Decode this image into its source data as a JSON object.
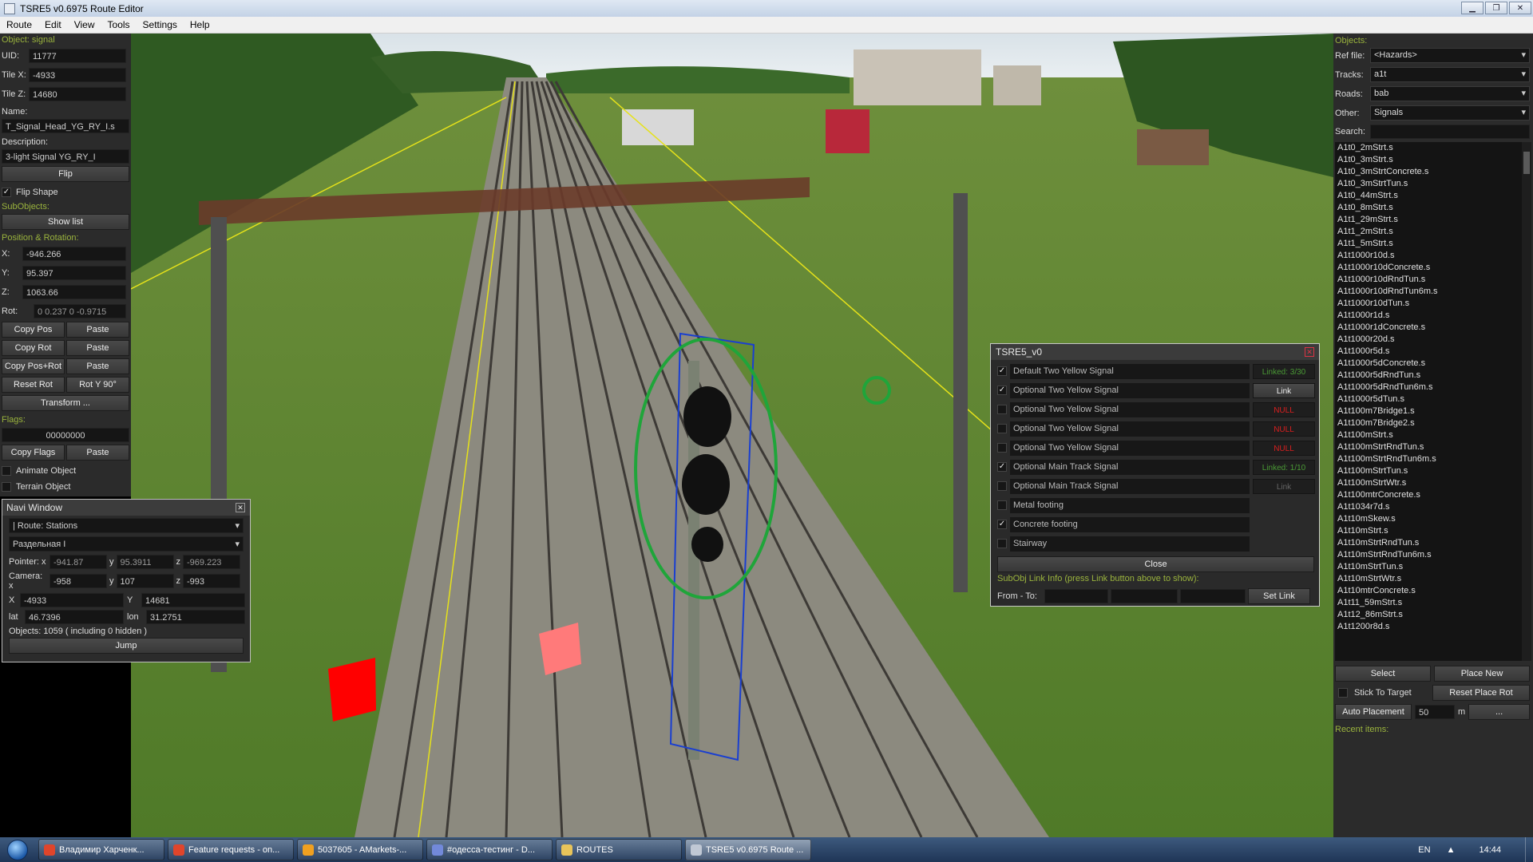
{
  "window": {
    "title": "TSRE5 v0.6975 Route Editor"
  },
  "menu": [
    "Route",
    "Edit",
    "View",
    "Tools",
    "Settings",
    "Help"
  ],
  "left": {
    "object_label": "Object: signal",
    "uid_label": "UID:",
    "uid": "11777",
    "tilex_label": "Tile X:",
    "tilex": "-4933",
    "tilez_label": "Tile Z:",
    "tilez": "14680",
    "name_label": "Name:",
    "name": "T_Signal_Head_YG_RY_I.s",
    "desc_label": "Description:",
    "desc": "3-light Signal YG_RY_I",
    "flip": "Flip",
    "flip_shape": "Flip Shape",
    "subobjects_label": "SubObjects:",
    "show_list": "Show list",
    "posrot_label": "Position & Rotation:",
    "x_label": "X:",
    "x": "-946.266",
    "y_label": "Y:",
    "y": "95.397",
    "z_label": "Z:",
    "z": "1063.66",
    "rot_label": "Rot:",
    "rot": "0 0.237 0 -0.9715",
    "copy_pos": "Copy Pos",
    "paste1": "Paste",
    "copy_rot": "Copy Rot",
    "paste2": "Paste",
    "copy_posrot": "Copy Pos+Rot",
    "paste3": "Paste",
    "reset_rot": "Reset Rot",
    "rot_y": "Rot Y 90°",
    "transform": "Transform ...",
    "flags_label": "Flags:",
    "flags": "00000000",
    "copy_flags": "Copy Flags",
    "paste4": "Paste",
    "animate": "Animate Object",
    "terrain": "Terrain Object"
  },
  "navi": {
    "title": "Navi Window",
    "route": "| Route: Stations",
    "station": "Раздельная I",
    "pointer_label": "Pointer: x",
    "pointer_x": "-941.87",
    "pointer_y": "95.3911",
    "pointer_z": "-969.223",
    "camera_label": "Camera: x",
    "camera_x": "-958",
    "camera_y": "107",
    "camera_z": "-993",
    "y_label": "y",
    "z_label": "z",
    "tx_label": "X",
    "tx": "-4933",
    "ty_label": "Y",
    "ty": "14681",
    "lat_label": "lat",
    "lat": "46.7396",
    "lon_label": "lon",
    "lon": "31.2751",
    "objects": "Objects: 1059 ( including 0 hidden )",
    "jump": "Jump"
  },
  "dialog": {
    "title": "TSRE5_v0",
    "rows": [
      {
        "checked": true,
        "name": "Default Two Yellow Signal",
        "link": "Linked: 3/30",
        "link_state": "green"
      },
      {
        "checked": true,
        "name": "Optional Two Yellow Signal",
        "link": "Link",
        "link_state": "active"
      },
      {
        "checked": false,
        "name": "Optional Two Yellow Signal",
        "link": "NULL",
        "link_state": "red"
      },
      {
        "checked": false,
        "name": "Optional Two Yellow Signal",
        "link": "NULL",
        "link_state": "red"
      },
      {
        "checked": false,
        "name": "Optional Two Yellow Signal",
        "link": "NULL",
        "link_state": "red"
      },
      {
        "checked": true,
        "name": "Optional Main Track Signal",
        "link": "Linked: 1/10",
        "link_state": "green"
      },
      {
        "checked": false,
        "name": "Optional Main Track Signal",
        "link": "Link",
        "link_state": "dim"
      },
      {
        "checked": false,
        "name": "Metal footing",
        "link": "",
        "link_state": ""
      },
      {
        "checked": true,
        "name": "Concrete footing",
        "link": "",
        "link_state": ""
      },
      {
        "checked": false,
        "name": "Stairway",
        "link": "",
        "link_state": ""
      }
    ],
    "close": "Close",
    "info": "SubObj Link Info (press Link button above to show):",
    "from_to": "From - To:",
    "set_link": "Set Link"
  },
  "right": {
    "objects_label": "Objects:",
    "ref_label": "Ref file:",
    "ref": "<Hazards>",
    "tracks_label": "Tracks:",
    "tracks": "a1t",
    "roads_label": "Roads:",
    "roads": "bab",
    "other_label": "Other:",
    "other": "Signals",
    "search_label": "Search:",
    "items": [
      "A1t0_2mStrt.s",
      "A1t0_3mStrt.s",
      "A1t0_3mStrtConcrete.s",
      "A1t0_3mStrtTun.s",
      "A1t0_44mStrt.s",
      "A1t0_8mStrt.s",
      "A1t1_29mStrt.s",
      "A1t1_2mStrt.s",
      "A1t1_5mStrt.s",
      "A1t1000r10d.s",
      "A1t1000r10dConcrete.s",
      "A1t1000r10dRndTun.s",
      "A1t1000r10dRndTun6m.s",
      "A1t1000r10dTun.s",
      "A1t1000r1d.s",
      "A1t1000r1dConcrete.s",
      "A1t1000r20d.s",
      "A1t1000r5d.s",
      "A1t1000r5dConcrete.s",
      "A1t1000r5dRndTun.s",
      "A1t1000r5dRndTun6m.s",
      "A1t1000r5dTun.s",
      "A1t100m7Bridge1.s",
      "A1t100m7Bridge2.s",
      "A1t100mStrt.s",
      "A1t100mStrtRndTun.s",
      "A1t100mStrtRndTun6m.s",
      "A1t100mStrtTun.s",
      "A1t100mStrtWtr.s",
      "A1t100mtrConcrete.s",
      "A1t1034r7d.s",
      "A1t10mSkew.s",
      "A1t10mStrt.s",
      "A1t10mStrtRndTun.s",
      "A1t10mStrtRndTun6m.s",
      "A1t10mStrtTun.s",
      "A1t10mStrtWtr.s",
      "A1t10mtrConcrete.s",
      "A1t11_59mStrt.s",
      "A1t12_86mStrt.s",
      "A1t1200r8d.s"
    ],
    "select": "Select",
    "place_new": "Place New",
    "stick": "Stick To Target",
    "reset_place": "Reset Place Rot",
    "auto": "Auto Placement",
    "auto_val": "50",
    "auto_unit": "m",
    "more": "...",
    "recent": "Recent items:"
  },
  "taskbar": {
    "tasks": [
      {
        "label": "Владимир Харченк...",
        "color": "#e0452b"
      },
      {
        "label": "Feature requests - on...",
        "color": "#e0452b"
      },
      {
        "label": "5037605 - AMarkets-...",
        "color": "#f0a020"
      },
      {
        "label": "#одесса-тестинг - D...",
        "color": "#7289da"
      },
      {
        "label": "ROUTES",
        "color": "#e8c45a"
      },
      {
        "label": "TSRE5 v0.6975 Route ...",
        "color": "#c0c8d4"
      }
    ],
    "lang": "EN",
    "clock": "14:44"
  }
}
